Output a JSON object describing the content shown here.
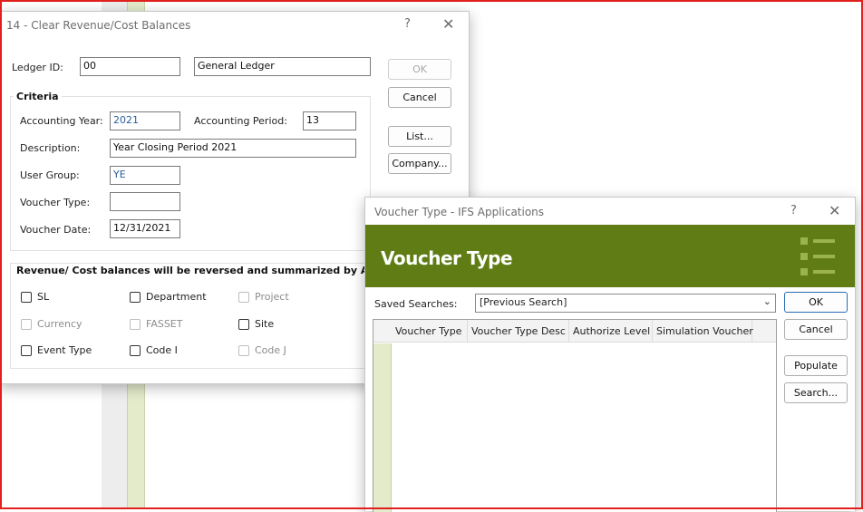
{
  "main_dialog": {
    "title": "14 - Clear Revenue/Cost Balances",
    "help": "?",
    "close": "✕",
    "ledger_id_label": "Ledger ID:",
    "ledger_id_value": "00",
    "ledger_desc_value": "General Ledger",
    "criteria_title": "Criteria",
    "accounting_year_label": "Accounting Year:",
    "accounting_year_value": "2021",
    "accounting_period_label": "Accounting Period:",
    "accounting_period_value": "13",
    "description_label": "Description:",
    "description_value": "Year Closing Period 2021",
    "user_group_label": "User Group:",
    "user_group_value": "YE",
    "voucher_type_label": "Voucher Type:",
    "voucher_type_value": "",
    "voucher_date_label": "Voucher Date:",
    "voucher_date_value": "12/31/2021",
    "ok": "OK",
    "cancel": "Cancel",
    "list": "List...",
    "company": "Company...",
    "summary_title": "Revenue/ Cost balances will be reversed and summarized by Accoun",
    "checkboxes": {
      "sl": "SL",
      "department": "Department",
      "project": "Project",
      "currency": "Currency",
      "fasset": "FASSET",
      "site": "Site",
      "event_type": "Event Type",
      "code_i": "Code I",
      "code_j": "Code J"
    }
  },
  "voucher_dialog": {
    "title": "Voucher Type  - IFS Applications",
    "help": "?",
    "close": "✕",
    "heading": "Voucher Type",
    "saved_searches_label": "Saved Searches:",
    "saved_searches_value": "[Previous Search]",
    "columns": [
      "Voucher Type",
      "Voucher Type Desc",
      "Authorize Level",
      "Simulation Voucher"
    ],
    "ok": "OK",
    "cancel": "Cancel",
    "populate": "Populate",
    "search": "Search..."
  },
  "colors": {
    "banner": "#5f7d14",
    "screen_border": "#e0201c",
    "row_header": "#e3ebcb"
  }
}
